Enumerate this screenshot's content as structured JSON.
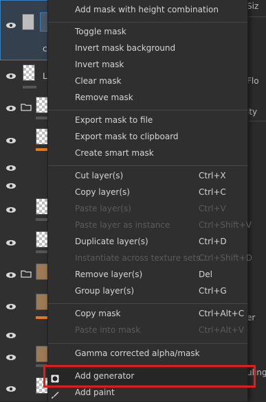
{
  "menu": {
    "groups": [
      [
        {
          "label": "Add mask with height combination",
          "shortcut": "",
          "enabled": true
        }
      ],
      [
        {
          "label": "Toggle mask",
          "shortcut": "",
          "enabled": true
        },
        {
          "label": "Invert mask background",
          "shortcut": "",
          "enabled": true
        },
        {
          "label": "Invert mask",
          "shortcut": "",
          "enabled": true
        },
        {
          "label": "Clear mask",
          "shortcut": "",
          "enabled": true
        },
        {
          "label": "Remove mask",
          "shortcut": "",
          "enabled": true
        }
      ],
      [
        {
          "label": "Export mask to file",
          "shortcut": "",
          "enabled": true
        },
        {
          "label": "Export mask to clipboard",
          "shortcut": "",
          "enabled": true
        },
        {
          "label": "Create smart mask",
          "shortcut": "",
          "enabled": true
        }
      ],
      [
        {
          "label": "Cut layer(s)",
          "shortcut": "Ctrl+X",
          "enabled": true
        },
        {
          "label": "Copy layer(s)",
          "shortcut": "Ctrl+C",
          "enabled": true
        },
        {
          "label": "Paste layer(s)",
          "shortcut": "Ctrl+V",
          "enabled": false
        },
        {
          "label": "Paste layer as instance",
          "shortcut": "Ctrl+Shift+V",
          "enabled": false
        },
        {
          "label": "Duplicate layer(s)",
          "shortcut": "Ctrl+D",
          "enabled": true
        },
        {
          "label": "Instantiate across texture sets...",
          "shortcut": "Ctrl+Shift+D",
          "enabled": false
        },
        {
          "label": "Remove layer(s)",
          "shortcut": "Del",
          "enabled": true
        },
        {
          "label": "Group layer(s)",
          "shortcut": "Ctrl+G",
          "enabled": true
        }
      ],
      [
        {
          "label": "Copy mask",
          "shortcut": "Ctrl+Alt+C",
          "enabled": true
        },
        {
          "label": "Paste into mask",
          "shortcut": "Ctrl+Alt+V",
          "enabled": false
        }
      ],
      [
        {
          "label": "Gamma corrected alpha/mask",
          "shortcut": "",
          "enabled": true
        }
      ],
      [
        {
          "label": "Add generator",
          "shortcut": "",
          "enabled": true,
          "highlighted": true,
          "icon": "generator-icon"
        },
        {
          "label": "Add paint",
          "shortcut": "",
          "enabled": true,
          "icon": "brush-icon"
        }
      ]
    ]
  },
  "layers": {
    "row_texts": [
      "c",
      "L"
    ]
  },
  "right_panel": {
    "texts": [
      "Siz",
      "Flo",
      "ity",
      "er",
      "uling"
    ]
  },
  "colors": {
    "highlight_border": "#e21b1b",
    "accent_orange": "#e07a1c",
    "selected_layer_border": "#3f7fb8"
  }
}
